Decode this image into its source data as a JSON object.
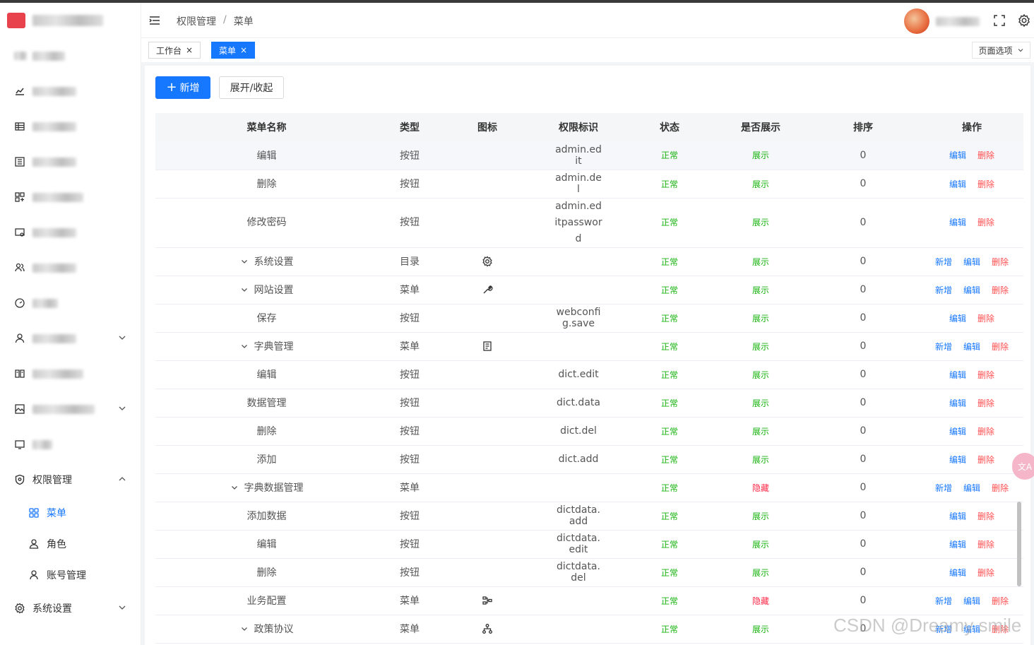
{
  "header": {
    "breadcrumb": [
      "权限管理",
      "菜单"
    ],
    "breadcrumb_sep": "/"
  },
  "tabs": [
    {
      "label": "工作台",
      "active": false
    },
    {
      "label": "菜单",
      "active": true
    }
  ],
  "tab_close": "×",
  "page_options": "页面选项",
  "sidebar": {
    "perm_group": "权限管理",
    "sub_items": [
      "菜单",
      "角色",
      "账号管理"
    ],
    "sys_group": "系统设置"
  },
  "toolbar": {
    "add_plus": "+",
    "add_label": "新增",
    "toggle_label": "展开/收起"
  },
  "table": {
    "columns": [
      "菜单名称",
      "类型",
      "图标",
      "权限标识",
      "状态",
      "是否展示",
      "排序",
      "操作"
    ],
    "rows": [
      {
        "name": "编辑",
        "type": "按钮",
        "perm": "admin.edit",
        "status": "正常",
        "show": "展示",
        "sort": "0",
        "actions": [
          "编辑",
          "删除"
        ]
      },
      {
        "name": "删除",
        "type": "按钮",
        "perm": "admin.del",
        "status": "正常",
        "show": "展示",
        "sort": "0",
        "actions": [
          "编辑",
          "删除"
        ]
      },
      {
        "name": "修改密码",
        "type": "按钮",
        "perm": "admin.editpassword",
        "status": "正常",
        "show": "展示",
        "sort": "0",
        "actions": [
          "编辑",
          "删除"
        ]
      },
      {
        "name": "系统设置",
        "type": "目录",
        "icon": "gear-icon",
        "perm": "",
        "status": "正常",
        "show": "展示",
        "sort": "0",
        "actions": [
          "新增",
          "编辑",
          "删除"
        ]
      },
      {
        "name": "网站设置",
        "type": "菜单",
        "icon": "wrench-icon",
        "perm": "",
        "status": "正常",
        "show": "展示",
        "sort": "0",
        "actions": [
          "新增",
          "编辑",
          "删除"
        ]
      },
      {
        "name": "保存",
        "type": "按钮",
        "perm": "webconfig.save",
        "status": "正常",
        "show": "展示",
        "sort": "0",
        "actions": [
          "编辑",
          "删除"
        ]
      },
      {
        "name": "字典管理",
        "type": "菜单",
        "icon": "document-icon",
        "perm": "",
        "status": "正常",
        "show": "展示",
        "sort": "0",
        "actions": [
          "新增",
          "编辑",
          "删除"
        ]
      },
      {
        "name": "编辑",
        "type": "按钮",
        "perm": "dict.edit",
        "status": "正常",
        "show": "展示",
        "sort": "0",
        "actions": [
          "编辑",
          "删除"
        ]
      },
      {
        "name": "数据管理",
        "type": "按钮",
        "perm": "dict.data",
        "status": "正常",
        "show": "展示",
        "sort": "0",
        "actions": [
          "编辑",
          "删除"
        ]
      },
      {
        "name": "删除",
        "type": "按钮",
        "perm": "dict.del",
        "status": "正常",
        "show": "展示",
        "sort": "0",
        "actions": [
          "编辑",
          "删除"
        ]
      },
      {
        "name": "添加",
        "type": "按钮",
        "perm": "dict.add",
        "status": "正常",
        "show": "展示",
        "sort": "0",
        "actions": [
          "编辑",
          "删除"
        ]
      },
      {
        "name": "字典数据管理",
        "type": "菜单",
        "perm": "",
        "status": "正常",
        "show": "隐藏",
        "sort": "0",
        "actions": [
          "新增",
          "编辑",
          "删除"
        ]
      },
      {
        "name": "添加数据",
        "type": "按钮",
        "perm": "dictdata.add",
        "status": "正常",
        "show": "展示",
        "sort": "0",
        "actions": [
          "编辑",
          "删除"
        ]
      },
      {
        "name": "编辑",
        "type": "按钮",
        "perm": "dictdata.edit",
        "status": "正常",
        "show": "展示",
        "sort": "0",
        "actions": [
          "编辑",
          "删除"
        ]
      },
      {
        "name": "删除",
        "type": "按钮",
        "perm": "dictdata.del",
        "status": "正常",
        "show": "展示",
        "sort": "0",
        "actions": [
          "编辑",
          "删除"
        ]
      },
      {
        "name": "业务配置",
        "type": "菜单",
        "icon": "workflow-icon",
        "perm": "",
        "status": "正常",
        "show": "隐藏",
        "sort": "0",
        "actions": [
          "新增",
          "编辑",
          "删除"
        ]
      },
      {
        "name": "政策协议",
        "type": "菜单",
        "icon": "hierarchy-icon",
        "perm": "",
        "status": "正常",
        "show": "展示",
        "sort": "0",
        "actions": [
          "新增",
          "编辑",
          "删除"
        ]
      }
    ]
  },
  "watermark": "CSDN @Dreamy smile",
  "translate_fab": "文A",
  "colors": {
    "primary": "#1677ff",
    "ok": "#17b30d",
    "hide": "#ff2b4a",
    "danger": "#ff4d4f"
  }
}
